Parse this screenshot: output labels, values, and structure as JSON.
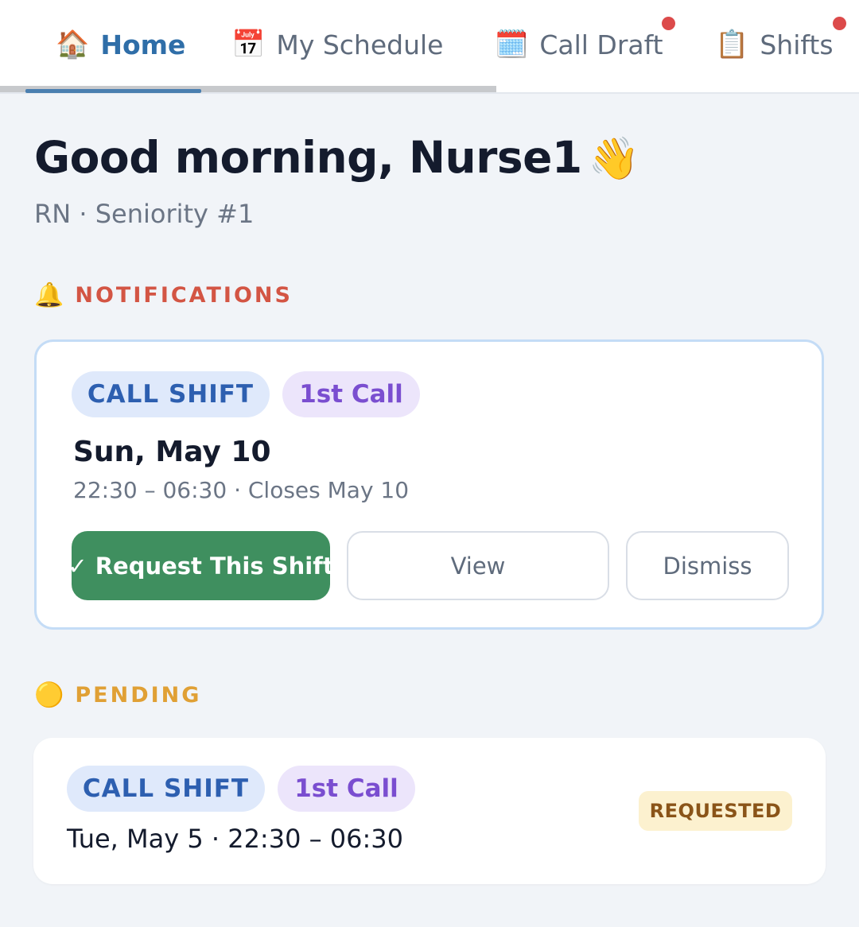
{
  "tabs": {
    "home": {
      "icon": "🏠",
      "label": "Home",
      "active": true
    },
    "schedule": {
      "icon": "📅",
      "label": "My Schedule"
    },
    "call_draft": {
      "icon": "🗓️",
      "label": "Call Draft",
      "has_notification": true
    },
    "shifts": {
      "icon": "📋",
      "label": "Shifts",
      "has_notification": true
    }
  },
  "greeting": {
    "text": "Good morning, Nurse1",
    "emoji": "👋",
    "subline": "RN · Seniority #1"
  },
  "notifications": {
    "icon": "🔔",
    "title": "NOTIFICATIONS",
    "card": {
      "type_label": "CALL SHIFT",
      "call_label": "1st Call",
      "date": "Sun, May 10",
      "meta": "22:30 – 06:30 · Closes May 10",
      "request_button": "✓ Request This Shift",
      "view_button": "View",
      "dismiss_button": "Dismiss"
    }
  },
  "pending": {
    "icon": "🟡",
    "title": "PENDING",
    "card": {
      "type_label": "CALL SHIFT",
      "call_label": "1st Call",
      "line": "Tue, May 5 · 22:30 – 06:30",
      "status": "REQUESTED"
    }
  },
  "colors": {
    "accent": "#2f6ea8",
    "request_green": "#3f8f5f",
    "notification_dot": "#dc4a4a",
    "notifications_heading": "#d35544",
    "pending_heading": "#e0a035"
  }
}
